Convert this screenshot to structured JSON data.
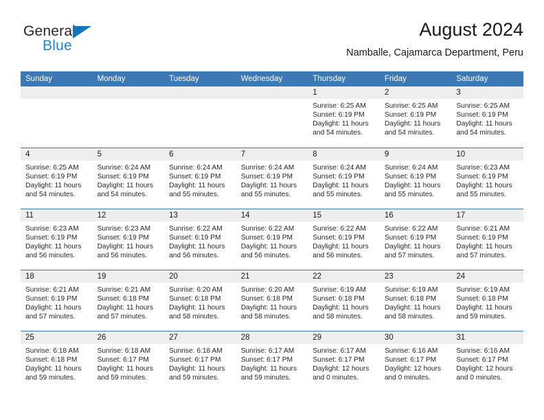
{
  "logo": {
    "word_one": "General",
    "word_two": "Blue",
    "triangle_color": "#1574bb",
    "blue_text_color": "#1f86d0"
  },
  "header": {
    "title": "August 2024",
    "subtitle": "Namballe, Cajamarca Department, Peru"
  },
  "theme": {
    "header_blue": "#3c79b4",
    "daynum_band": "#eeeeee",
    "text_color": "#262626"
  },
  "weekday_headers": [
    "Sunday",
    "Monday",
    "Tuesday",
    "Wednesday",
    "Thursday",
    "Friday",
    "Saturday"
  ],
  "labels": {
    "sunrise_prefix": "Sunrise:",
    "sunset_prefix": "Sunset:",
    "daylight_prefix": "Daylight:"
  },
  "weeks": [
    [
      {
        "day": "",
        "empty": true
      },
      {
        "day": "",
        "empty": true
      },
      {
        "day": "",
        "empty": true
      },
      {
        "day": "",
        "empty": true
      },
      {
        "day": "1",
        "sunrise": "Sunrise: 6:25 AM",
        "sunset": "Sunset: 6:19 PM",
        "daylight_a": "Daylight: 11 hours",
        "daylight_b": "and 54 minutes."
      },
      {
        "day": "2",
        "sunrise": "Sunrise: 6:25 AM",
        "sunset": "Sunset: 6:19 PM",
        "daylight_a": "Daylight: 11 hours",
        "daylight_b": "and 54 minutes."
      },
      {
        "day": "3",
        "sunrise": "Sunrise: 6:25 AM",
        "sunset": "Sunset: 6:19 PM",
        "daylight_a": "Daylight: 11 hours",
        "daylight_b": "and 54 minutes."
      }
    ],
    [
      {
        "day": "4",
        "sunrise": "Sunrise: 6:25 AM",
        "sunset": "Sunset: 6:19 PM",
        "daylight_a": "Daylight: 11 hours",
        "daylight_b": "and 54 minutes."
      },
      {
        "day": "5",
        "sunrise": "Sunrise: 6:24 AM",
        "sunset": "Sunset: 6:19 PM",
        "daylight_a": "Daylight: 11 hours",
        "daylight_b": "and 54 minutes."
      },
      {
        "day": "6",
        "sunrise": "Sunrise: 6:24 AM",
        "sunset": "Sunset: 6:19 PM",
        "daylight_a": "Daylight: 11 hours",
        "daylight_b": "and 55 minutes."
      },
      {
        "day": "7",
        "sunrise": "Sunrise: 6:24 AM",
        "sunset": "Sunset: 6:19 PM",
        "daylight_a": "Daylight: 11 hours",
        "daylight_b": "and 55 minutes."
      },
      {
        "day": "8",
        "sunrise": "Sunrise: 6:24 AM",
        "sunset": "Sunset: 6:19 PM",
        "daylight_a": "Daylight: 11 hours",
        "daylight_b": "and 55 minutes."
      },
      {
        "day": "9",
        "sunrise": "Sunrise: 6:24 AM",
        "sunset": "Sunset: 6:19 PM",
        "daylight_a": "Daylight: 11 hours",
        "daylight_b": "and 55 minutes."
      },
      {
        "day": "10",
        "sunrise": "Sunrise: 6:23 AM",
        "sunset": "Sunset: 6:19 PM",
        "daylight_a": "Daylight: 11 hours",
        "daylight_b": "and 55 minutes."
      }
    ],
    [
      {
        "day": "11",
        "sunrise": "Sunrise: 6:23 AM",
        "sunset": "Sunset: 6:19 PM",
        "daylight_a": "Daylight: 11 hours",
        "daylight_b": "and 56 minutes."
      },
      {
        "day": "12",
        "sunrise": "Sunrise: 6:23 AM",
        "sunset": "Sunset: 6:19 PM",
        "daylight_a": "Daylight: 11 hours",
        "daylight_b": "and 56 minutes."
      },
      {
        "day": "13",
        "sunrise": "Sunrise: 6:22 AM",
        "sunset": "Sunset: 6:19 PM",
        "daylight_a": "Daylight: 11 hours",
        "daylight_b": "and 56 minutes."
      },
      {
        "day": "14",
        "sunrise": "Sunrise: 6:22 AM",
        "sunset": "Sunset: 6:19 PM",
        "daylight_a": "Daylight: 11 hours",
        "daylight_b": "and 56 minutes."
      },
      {
        "day": "15",
        "sunrise": "Sunrise: 6:22 AM",
        "sunset": "Sunset: 6:19 PM",
        "daylight_a": "Daylight: 11 hours",
        "daylight_b": "and 56 minutes."
      },
      {
        "day": "16",
        "sunrise": "Sunrise: 6:22 AM",
        "sunset": "Sunset: 6:19 PM",
        "daylight_a": "Daylight: 11 hours",
        "daylight_b": "and 57 minutes."
      },
      {
        "day": "17",
        "sunrise": "Sunrise: 6:21 AM",
        "sunset": "Sunset: 6:19 PM",
        "daylight_a": "Daylight: 11 hours",
        "daylight_b": "and 57 minutes."
      }
    ],
    [
      {
        "day": "18",
        "sunrise": "Sunrise: 6:21 AM",
        "sunset": "Sunset: 6:19 PM",
        "daylight_a": "Daylight: 11 hours",
        "daylight_b": "and 57 minutes."
      },
      {
        "day": "19",
        "sunrise": "Sunrise: 6:21 AM",
        "sunset": "Sunset: 6:18 PM",
        "daylight_a": "Daylight: 11 hours",
        "daylight_b": "and 57 minutes."
      },
      {
        "day": "20",
        "sunrise": "Sunrise: 6:20 AM",
        "sunset": "Sunset: 6:18 PM",
        "daylight_a": "Daylight: 11 hours",
        "daylight_b": "and 58 minutes."
      },
      {
        "day": "21",
        "sunrise": "Sunrise: 6:20 AM",
        "sunset": "Sunset: 6:18 PM",
        "daylight_a": "Daylight: 11 hours",
        "daylight_b": "and 58 minutes."
      },
      {
        "day": "22",
        "sunrise": "Sunrise: 6:19 AM",
        "sunset": "Sunset: 6:18 PM",
        "daylight_a": "Daylight: 11 hours",
        "daylight_b": "and 58 minutes."
      },
      {
        "day": "23",
        "sunrise": "Sunrise: 6:19 AM",
        "sunset": "Sunset: 6:18 PM",
        "daylight_a": "Daylight: 11 hours",
        "daylight_b": "and 58 minutes."
      },
      {
        "day": "24",
        "sunrise": "Sunrise: 6:19 AM",
        "sunset": "Sunset: 6:18 PM",
        "daylight_a": "Daylight: 11 hours",
        "daylight_b": "and 59 minutes."
      }
    ],
    [
      {
        "day": "25",
        "sunrise": "Sunrise: 6:18 AM",
        "sunset": "Sunset: 6:18 PM",
        "daylight_a": "Daylight: 11 hours",
        "daylight_b": "and 59 minutes."
      },
      {
        "day": "26",
        "sunrise": "Sunrise: 6:18 AM",
        "sunset": "Sunset: 6:17 PM",
        "daylight_a": "Daylight: 11 hours",
        "daylight_b": "and 59 minutes."
      },
      {
        "day": "27",
        "sunrise": "Sunrise: 6:18 AM",
        "sunset": "Sunset: 6:17 PM",
        "daylight_a": "Daylight: 11 hours",
        "daylight_b": "and 59 minutes."
      },
      {
        "day": "28",
        "sunrise": "Sunrise: 6:17 AM",
        "sunset": "Sunset: 6:17 PM",
        "daylight_a": "Daylight: 11 hours",
        "daylight_b": "and 59 minutes."
      },
      {
        "day": "29",
        "sunrise": "Sunrise: 6:17 AM",
        "sunset": "Sunset: 6:17 PM",
        "daylight_a": "Daylight: 12 hours",
        "daylight_b": "and 0 minutes."
      },
      {
        "day": "30",
        "sunrise": "Sunrise: 6:16 AM",
        "sunset": "Sunset: 6:17 PM",
        "daylight_a": "Daylight: 12 hours",
        "daylight_b": "and 0 minutes."
      },
      {
        "day": "31",
        "sunrise": "Sunrise: 6:16 AM",
        "sunset": "Sunset: 6:17 PM",
        "daylight_a": "Daylight: 12 hours",
        "daylight_b": "and 0 minutes."
      }
    ]
  ]
}
